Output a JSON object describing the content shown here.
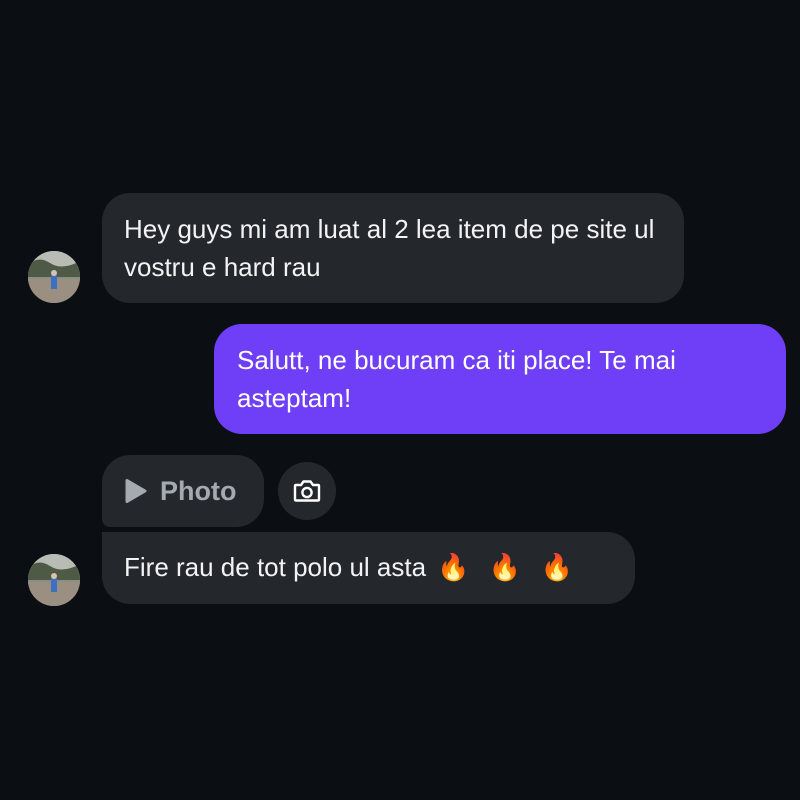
{
  "conversation": {
    "messages": [
      {
        "sender": "contact",
        "text": "Hey guys mi am luat al 2 lea item de pe site ul vostru e hard rau"
      },
      {
        "sender": "me",
        "text": "Salutt, ne bucuram ca iti place! Te mai asteptam!"
      },
      {
        "sender": "contact",
        "type": "attachment",
        "label": "Photo",
        "icon": "play-icon"
      },
      {
        "sender": "contact",
        "text": "Fire rau de tot polo ul asta",
        "emoji": "🔥 🔥 🔥"
      }
    ],
    "camera_icon": "camera-icon"
  },
  "colors": {
    "background": "#0b0f13",
    "incoming_bubble": "#24282c",
    "outgoing_bubble": "#6e3ff6",
    "attachment_label": "#a5aab1"
  }
}
